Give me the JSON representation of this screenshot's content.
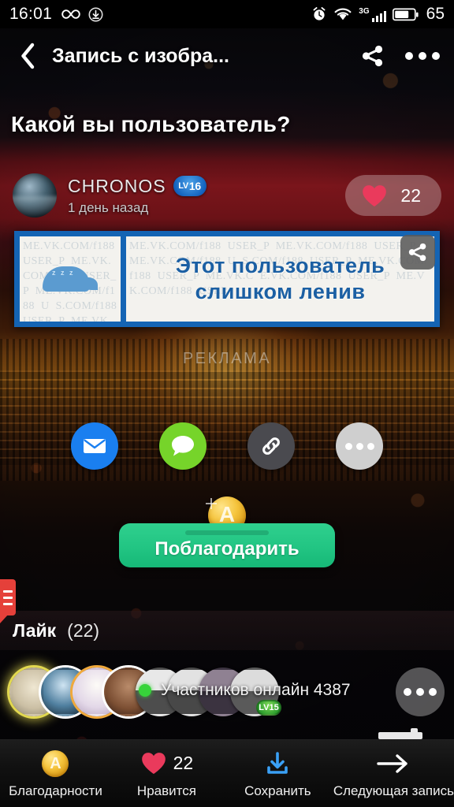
{
  "status_bar": {
    "time": "16:01",
    "icons_left": [
      "infinity-icon",
      "download-circle-icon"
    ],
    "icons_right": [
      "alarm-icon",
      "wifi-icon",
      "signal-3g-icon",
      "battery-icon"
    ],
    "network": "3G",
    "battery_level": "65"
  },
  "app_bar": {
    "back_icon": "chevron-left-icon",
    "title": "Запись с изобра...",
    "share_icon": "share-icon",
    "overflow_icon": "more-horizontal-icon"
  },
  "post": {
    "title": "Какой вы пользователь?",
    "author": {
      "name": "CHRONOS",
      "level_prefix": "LV",
      "level": "16",
      "timestamp": "1 день назад"
    },
    "like_pill": {
      "icon": "heart-icon",
      "count": "22"
    },
    "image": {
      "left_icon": "sleeping-whale-icon",
      "watermark": "ME.VK.COM/f188  USER_P  ME.VK.COM/f188  USER_P  ME.VK.COM/f188  U  S.COM/f188  USER_P  ME.VK.COM/f188  USER_P  ME.VK.C  E.VK.COM/f188  USER_P  ME.VK.COM/f188  USER",
      "text_line1": "Этот пользователь",
      "text_line2": "слишком ленив",
      "share_overlay_icon": "share-icon"
    },
    "ad_label": "РЕКЛАМА"
  },
  "share_buttons": [
    {
      "name": "email-share-button",
      "icon": "envelope-icon",
      "color": "#1a7ff0"
    },
    {
      "name": "message-share-button",
      "icon": "chat-bubble-icon",
      "color": "#76d42a"
    },
    {
      "name": "copy-link-button",
      "icon": "link-icon",
      "color": "#4a4a4f"
    },
    {
      "name": "more-share-button",
      "icon": "more-horizontal-icon",
      "color": "#cfcfcf"
    }
  ],
  "thank": {
    "coin_letter": "A",
    "button_label": "Поблагодарить",
    "button_color": "#22c583"
  },
  "edge_tab": {
    "icon": "list-menu-icon",
    "color": "#e5403a"
  },
  "like_section": {
    "label": "Лайк",
    "count": "(22)"
  },
  "participants": {
    "avatars": [
      {
        "name": "participant-avatar-1",
        "ring": "ring-y"
      },
      {
        "name": "participant-avatar-2",
        "ring": "ring-w"
      },
      {
        "name": "participant-avatar-3",
        "ring": "ring-o"
      },
      {
        "name": "participant-avatar-4",
        "ring": "ring-w"
      },
      {
        "name": "participant-avatar-5",
        "ring": ""
      },
      {
        "name": "participant-avatar-6",
        "ring": ""
      },
      {
        "name": "participant-avatar-7",
        "ring": ""
      },
      {
        "name": "participant-avatar-8",
        "ring": "",
        "level_prefix": "LV",
        "level": "15"
      }
    ],
    "online_text": "Участников онлайн 4387",
    "more_icon": "more-horizontal-icon"
  },
  "bottom_nav": [
    {
      "name": "nav-thanks",
      "icon": "coin-icon",
      "coin_letter": "A",
      "label": "Благодарности",
      "count": ""
    },
    {
      "name": "nav-like",
      "icon": "heart-icon",
      "label": "Нравится",
      "count": "22"
    },
    {
      "name": "nav-save",
      "icon": "download-icon",
      "label": "Сохранить",
      "count": ""
    },
    {
      "name": "nav-next",
      "icon": "arrow-right-icon",
      "label": "Следующая запись",
      "count": ""
    }
  ],
  "colors": {
    "accent_green": "#22c583",
    "accent_blue": "#1a7ff0",
    "heart_red": "#ea3a5c",
    "level_blue": "#1565c0",
    "level_green": "#2e9e2e",
    "save_blue": "#3aa0f5"
  }
}
